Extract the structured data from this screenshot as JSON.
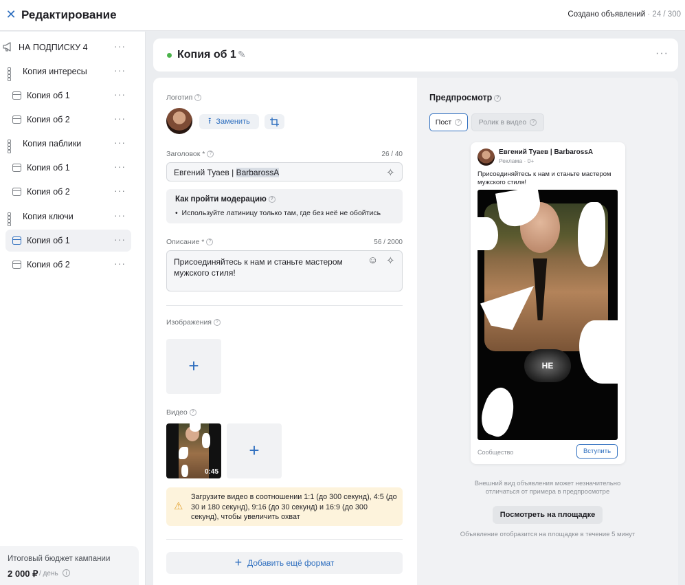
{
  "header": {
    "title": "Редактирование",
    "counter_label": "Создано объявлений",
    "counter_value": "· 24 / 300"
  },
  "sidebar": {
    "campaign": {
      "label": "НА ПОДПИСКУ 4",
      "icon": "megaphone-icon"
    },
    "groups": [
      {
        "label": "Копия интересы",
        "ads": [
          "Копия об 1",
          "Копия об 2"
        ]
      },
      {
        "label": "Копия паблики",
        "ads": [
          "Копия об 1",
          "Копия об 2"
        ]
      },
      {
        "label": "Копия ключи",
        "ads": [
          "Копия об 1",
          "Копия об 2"
        ]
      }
    ],
    "active_item": "Копия ключи / Копия об 1",
    "budget_label": "Итоговый бюджет кампании",
    "budget_value": "2 000 ₽",
    "budget_period": "/ день"
  },
  "ad": {
    "name": "Копия об 1",
    "status_color": "#4bb34b"
  },
  "editor": {
    "logo_label": "Логотип",
    "replace_label": "Заменить",
    "headline_label": "Заголовок *",
    "headline_counter": "26 / 40",
    "headline_prefix": "Евгений Туаев | ",
    "headline_selected": "BarbarossA",
    "moderation_title": "Как пройти модерацию",
    "moderation_tip": "Используйте латиницу только там, где без неё не обойтись",
    "description_label": "Описание *",
    "description_counter": "56 / 2000",
    "description_value": "Присоединяйтесь к нам и станьте мастером мужского стиля!",
    "images_label": "Изображения",
    "video_label": "Видео",
    "video_duration": "0:45",
    "video_hint": "Загрузите видео в соотношении 1:1 (до 300 секунд), 4:5 (до 30 и 180 секунд), 9:16 (до 30 секунд) и 16:9 (до 300 секунд), чтобы увеличить охват",
    "add_format_label": "Добавить ещё формат"
  },
  "preview": {
    "title": "Предпросмотр",
    "tab_post": "Пост",
    "tab_video": "Ролик в видео",
    "author": "Евгений Туаев | BarbarossA",
    "sublabel": "Реклама · 0+",
    "text": "Присоединяйтесь к нам и станьте мастером мужского стиля!",
    "caption": "НЕ",
    "brand": "Сообщество",
    "join_label": "Вступить",
    "disclaimer": "Внешний вид объявления может незначительно отличаться от примера в предпросмотре",
    "view_button": "Посмотреть на площадке",
    "note": "Объявление отобразится на площадке в течение 5 минут"
  },
  "colors": {
    "accent": "#2f6fbf",
    "status_active": "#4bb34b",
    "warning_bg": "#fdf3dc"
  }
}
